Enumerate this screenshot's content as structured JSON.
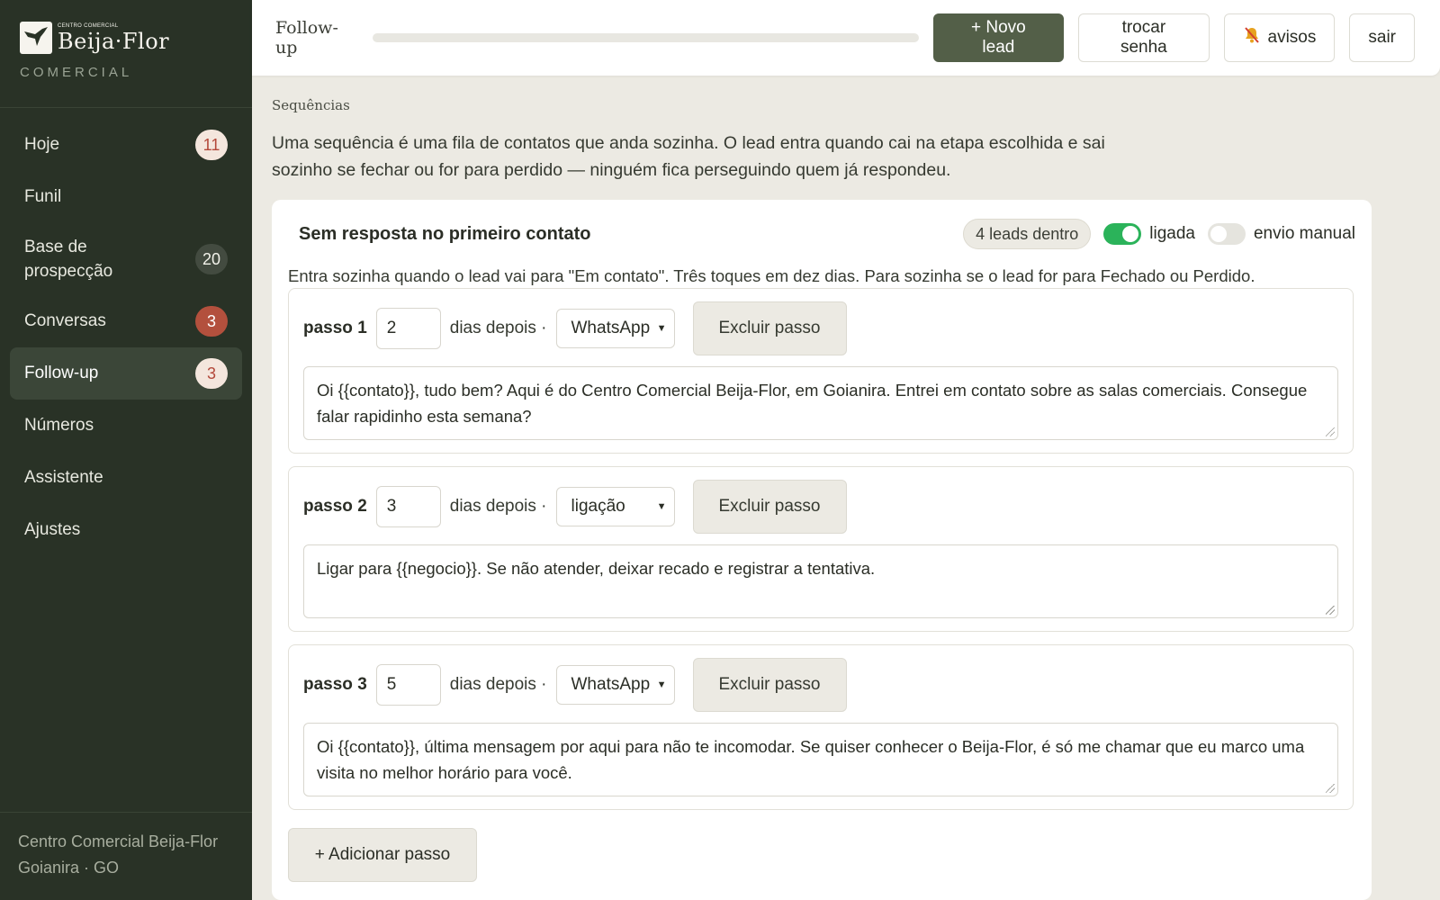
{
  "brand": {
    "small": "CENTRO COMERCIAL",
    "name": "Beija·Flor",
    "sub": "COMERCIAL"
  },
  "sidebar": {
    "items": [
      {
        "label": "Hoje",
        "badge": "11"
      },
      {
        "label": "Funil",
        "badge": ""
      },
      {
        "label": "Base de prospecção",
        "badge": "20"
      },
      {
        "label": "Conversas",
        "badge": "3"
      },
      {
        "label": "Follow-up",
        "badge": "3"
      },
      {
        "label": "Números",
        "badge": ""
      },
      {
        "label": "Assistente",
        "badge": ""
      },
      {
        "label": "Ajustes",
        "badge": ""
      }
    ],
    "active": "Follow-up",
    "footer_line1": "Centro Comercial Beija-Flor",
    "footer_line2": "Goianira · GO"
  },
  "topbar": {
    "title": "Follow-up",
    "new_lead": "+ Novo lead",
    "change_password": "trocar senha",
    "alerts": "avisos",
    "alerts_icon": "bell-muted-icon",
    "logout": "sair"
  },
  "main": {
    "section_label": "Sequências",
    "intro": "Uma sequência é uma fila de contatos que anda sozinha. O lead entra quando cai na etapa escolhida e sai sozinho se fechar ou for para perdido — ninguém fica perseguindo quem já respondeu."
  },
  "sequence": {
    "title": "Sem resposta no primeiro contato",
    "leads_pill": "4 leads dentro",
    "toggle_on_label": "ligada",
    "toggle_on": true,
    "toggle_manual_label": "envio manual",
    "toggle_manual": false,
    "description": "Entra sozinha quando o lead vai para \"Em contato\". Três toques em dez dias. Para sozinha se o lead for para Fechado ou Perdido.",
    "days_label": "dias depois ·",
    "delete_label": "Excluir passo",
    "add_step": "+ Adicionar passo",
    "steps": [
      {
        "label": "passo 1",
        "days": "2",
        "channel": "WhatsApp",
        "message": "Oi {{contato}}, tudo bem? Aqui é do Centro Comercial Beija-Flor, em Goianira. Entrei em contato sobre as salas comerciais. Consegue falar rapidinho esta semana?"
      },
      {
        "label": "passo 2",
        "days": "3",
        "channel": "ligação",
        "message": "Ligar para {{negocio}}. Se não atender, deixar recado e registrar a tentativa."
      },
      {
        "label": "passo 3",
        "days": "5",
        "channel": "WhatsApp",
        "message": "Oi {{contato}}, última mensagem por aqui para não te incomodar. Se quiser conhecer o Beija-Flor, é só me chamar que eu marco uma visita no melhor horário para você."
      }
    ]
  }
}
